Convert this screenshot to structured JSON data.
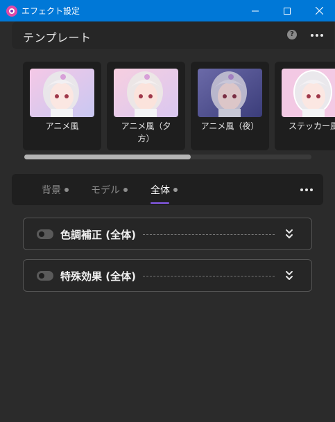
{
  "window": {
    "title": "エフェクト設定",
    "accent": "#0078d7"
  },
  "template": {
    "title": "テンプレート",
    "help_symbol": "?",
    "cards": [
      {
        "label": "アニメ風"
      },
      {
        "label": "アニメ風（夕\n方）"
      },
      {
        "label": "アニメ風（夜）"
      },
      {
        "label": "ステッカー風"
      }
    ],
    "scroll_fraction": 0.58
  },
  "tabs": [
    {
      "label": "背景",
      "active": false
    },
    {
      "label": "モデル",
      "active": false
    },
    {
      "label": "全体",
      "active": true
    }
  ],
  "tab_accent": "#8a5cf0",
  "sections": [
    {
      "label": "色調補正 (全体)",
      "enabled": false
    },
    {
      "label": "特殊効果 (全体)",
      "enabled": false
    }
  ]
}
